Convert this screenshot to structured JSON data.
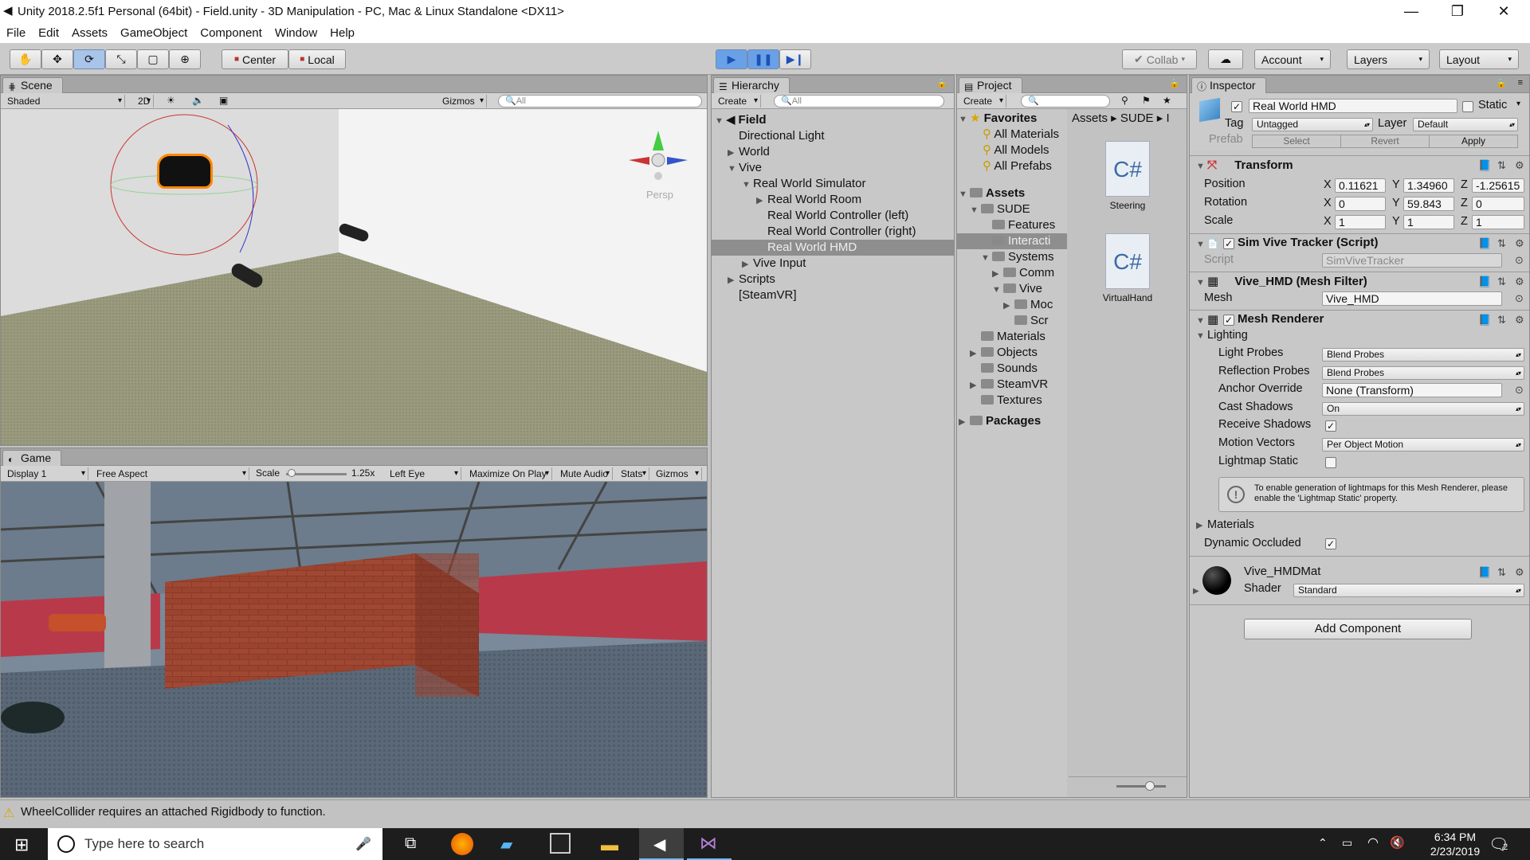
{
  "window": {
    "title": "Unity 2018.2.5f1 Personal (64bit) - Field.unity - 3D Manipulation - PC, Mac & Linux Standalone <DX11>",
    "min": "—",
    "max": "❐",
    "close": "✕"
  },
  "menu": [
    "File",
    "Edit",
    "Assets",
    "GameObject",
    "Component",
    "Window",
    "Help"
  ],
  "toolbar": {
    "center": "Center",
    "local": "Local",
    "collab": "Collab",
    "account": "Account",
    "layers": "Layers",
    "layout": "Layout"
  },
  "scene": {
    "tab": "Scene",
    "shading": "Shaded",
    "mode2d": "2D",
    "gizmos": "Gizmos",
    "search": "All",
    "persp": "Persp"
  },
  "game": {
    "tab": "Game",
    "display": "Display 1",
    "aspect": "Free Aspect",
    "scale_label": "Scale",
    "scale_value": "1.25x",
    "eye": "Left Eye",
    "maximize": "Maximize On Play",
    "mute": "Mute Audio",
    "stats": "Stats",
    "gizmos": "Gizmos"
  },
  "hierarchy": {
    "tab": "Hierarchy",
    "create": "Create",
    "search": "All",
    "scene_name": "Field",
    "items": [
      {
        "label": "Directional Light",
        "indent": 0,
        "arrow": ""
      },
      {
        "label": "World",
        "indent": 0,
        "arrow": "▶"
      },
      {
        "label": "Vive",
        "indent": 0,
        "arrow": "▼"
      },
      {
        "label": "Real World Simulator",
        "indent": 1,
        "arrow": "▼"
      },
      {
        "label": "Real World Room",
        "indent": 2,
        "arrow": "▶"
      },
      {
        "label": "Real World Controller (left)",
        "indent": 2,
        "arrow": ""
      },
      {
        "label": "Real World Controller (right)",
        "indent": 2,
        "arrow": ""
      },
      {
        "label": "Real World HMD",
        "indent": 2,
        "arrow": "",
        "selected": true
      },
      {
        "label": "Vive Input",
        "indent": 1,
        "arrow": "▶"
      },
      {
        "label": "Scripts",
        "indent": 0,
        "arrow": "▶"
      },
      {
        "label": "[SteamVR]",
        "indent": 0,
        "arrow": ""
      }
    ]
  },
  "project": {
    "tab": "Project",
    "create": "Create",
    "breadcrumb": [
      "Assets",
      "SUDE",
      "I"
    ],
    "favorites": {
      "label": "Favorites",
      "items": [
        "All Materials",
        "All Models",
        "All Prefabs"
      ]
    },
    "assets": {
      "label": "Assets"
    },
    "tree": [
      {
        "label": "SUDE",
        "indent": 1,
        "arrow": "▼"
      },
      {
        "label": "Features",
        "indent": 2,
        "arrow": ""
      },
      {
        "label": "Interacti",
        "indent": 2,
        "arrow": "",
        "selected": true
      },
      {
        "label": "Systems",
        "indent": 2,
        "arrow": "▼"
      },
      {
        "label": "Comm",
        "indent": 3,
        "arrow": "▶"
      },
      {
        "label": "Vive",
        "indent": 3,
        "arrow": "▼"
      },
      {
        "label": "Moc",
        "indent": 4,
        "arrow": "▶"
      },
      {
        "label": "Scr",
        "indent": 4,
        "arrow": ""
      },
      {
        "label": "Materials",
        "indent": 1,
        "arrow": ""
      },
      {
        "label": "Objects",
        "indent": 1,
        "arrow": "▶"
      },
      {
        "label": "Sounds",
        "indent": 1,
        "arrow": ""
      },
      {
        "label": "SteamVR",
        "indent": 1,
        "arrow": "▶"
      },
      {
        "label": "Textures",
        "indent": 1,
        "arrow": ""
      }
    ],
    "packages": "Packages",
    "files": [
      {
        "icon": "C#",
        "name": "Steering"
      },
      {
        "icon": "C#",
        "name": "VirtualHand"
      }
    ]
  },
  "inspector": {
    "tab": "Inspector",
    "name": "Real World HMD",
    "static": "Static",
    "tag_label": "Tag",
    "tag": "Untagged",
    "layer_label": "Layer",
    "layer": "Default",
    "prefab": "Prefab",
    "select": "Select",
    "revert": "Revert",
    "apply": "Apply",
    "transform": {
      "title": "Transform",
      "position": "Position",
      "rotation": "Rotation",
      "scale": "Scale",
      "pos": [
        "0.11621",
        "1.34960",
        "-1.25615"
      ],
      "rot": [
        "0",
        "59.843",
        "0"
      ],
      "scl": [
        "1",
        "1",
        "1"
      ]
    },
    "tracker": {
      "title": "Sim Vive Tracker (Script)",
      "script_label": "Script",
      "script": "SimViveTracker"
    },
    "meshfilter": {
      "title": "Vive_HMD (Mesh Filter)",
      "mesh_label": "Mesh",
      "mesh": "Vive_HMD"
    },
    "renderer": {
      "title": "Mesh Renderer",
      "lighting": "Lighting",
      "fields": [
        {
          "label": "Light Probes",
          "value": "Blend Probes",
          "kind": "select"
        },
        {
          "label": "Reflection Probes",
          "value": "Blend Probes",
          "kind": "select"
        },
        {
          "label": "Anchor Override",
          "value": "None (Transform)",
          "kind": "object"
        },
        {
          "label": "Cast Shadows",
          "value": "On",
          "kind": "select"
        },
        {
          "label": "Receive Shadows",
          "value": "✓",
          "kind": "check"
        },
        {
          "label": "Motion Vectors",
          "value": "Per Object Motion",
          "kind": "select"
        },
        {
          "label": "Lightmap Static",
          "value": "",
          "kind": "check"
        }
      ],
      "help": "To enable generation of lightmaps for this Mesh Renderer, please enable the 'Lightmap Static' property.",
      "materials": "Materials",
      "dynamic": "Dynamic Occluded"
    },
    "material": {
      "name": "Vive_HMDMat",
      "shader_label": "Shader",
      "shader": "Standard"
    },
    "add_component": "Add Component"
  },
  "status": {
    "message": "WheelCollider requires an attached Rigidbody to function."
  },
  "taskbar": {
    "search": "Type here to search",
    "time": "6:34 PM",
    "date": "2/23/2019",
    "notif": "2"
  }
}
